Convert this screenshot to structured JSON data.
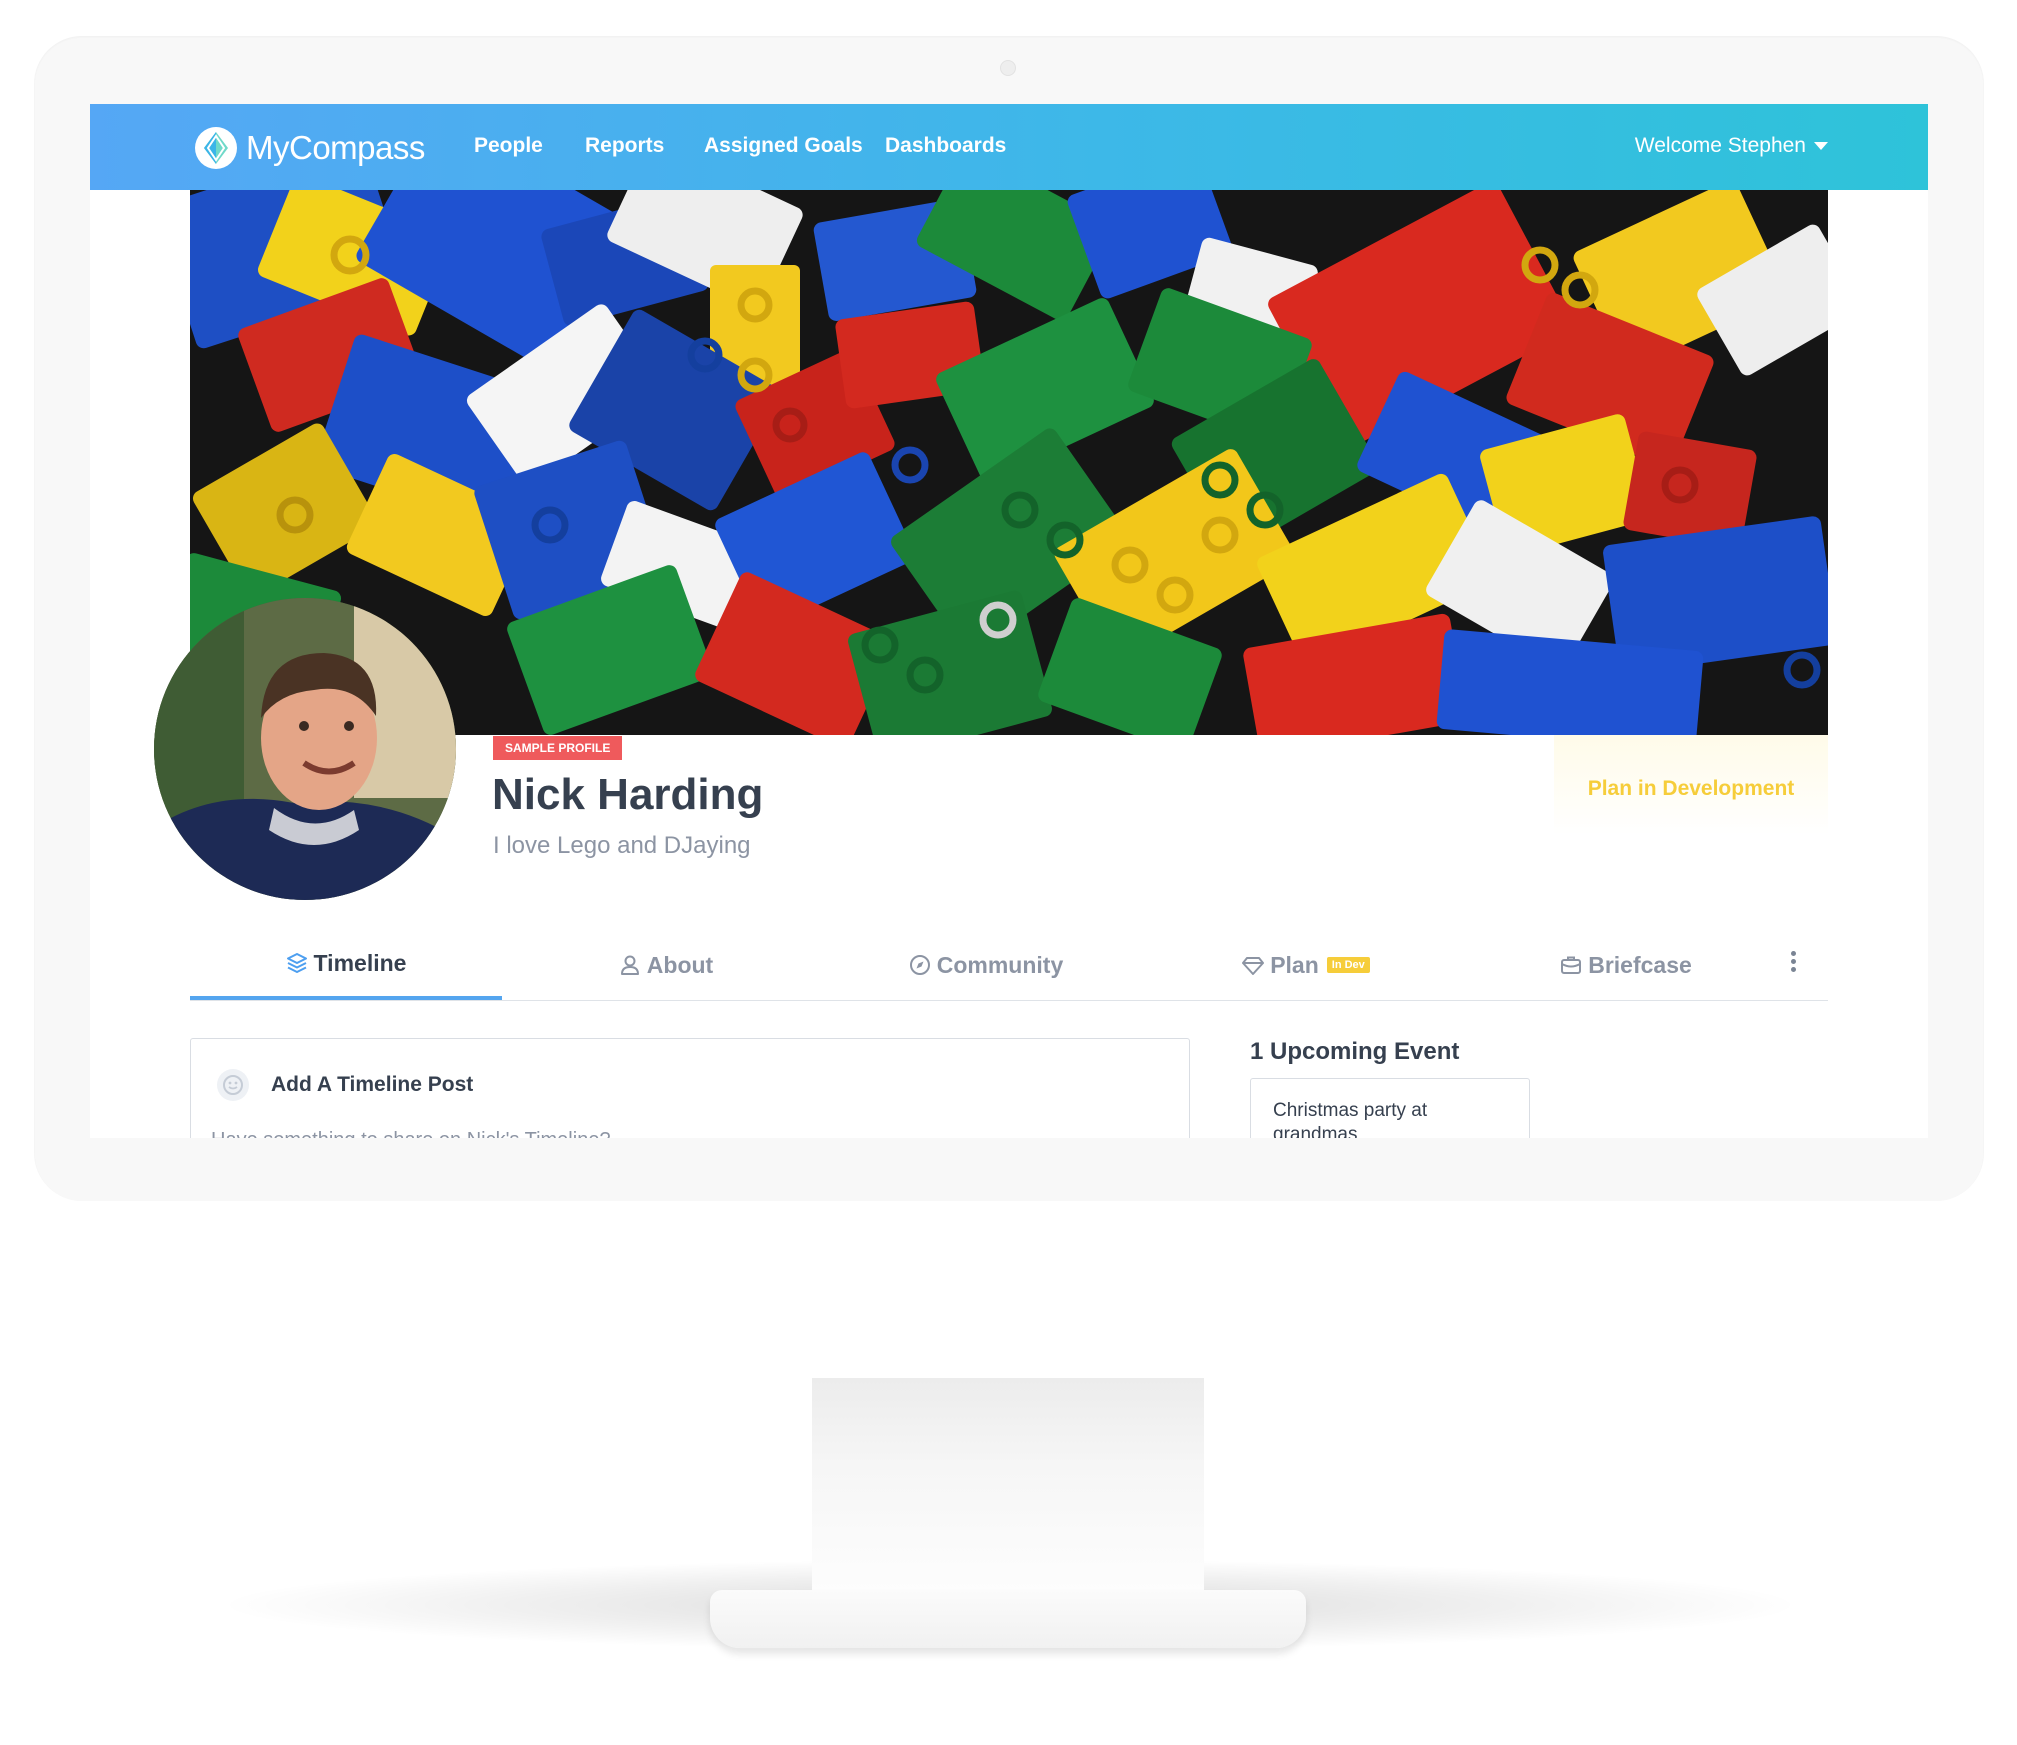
{
  "app": {
    "brand": "MyCompass",
    "nav": {
      "people": "People",
      "reports": "Reports",
      "assigned_goals": "Assigned Goals",
      "dashboards": "Dashboards"
    },
    "welcome": "Welcome Stephen"
  },
  "profile": {
    "badge": "SAMPLE PROFILE",
    "name": "Nick Harding",
    "bio": "I love Lego and DJaying",
    "plan_status": "Plan in Development"
  },
  "tabs": {
    "timeline": "Timeline",
    "about": "About",
    "community": "Community",
    "plan": "Plan",
    "plan_badge": "In Dev",
    "briefcase": "Briefcase",
    "active": "Timeline"
  },
  "timeline_post": {
    "title": "Add A Timeline Post",
    "placeholder": "Have something to share on Nick's Timeline?"
  },
  "events": {
    "title": "1 Upcoming Event",
    "items": [
      {
        "title": "Christmas party at grandmas"
      }
    ]
  },
  "colors": {
    "nav_gradient_start": "#55a7f5",
    "nav_gradient_end": "#2ec3d9",
    "sample_badge": "#ef5a5c",
    "plan_yellow": "#f6cd3a",
    "active_tab_underline": "#54a5ef",
    "heading_text": "#36404f",
    "muted_text": "#8c94a3"
  },
  "icons": {
    "brand": "compass-logo-icon",
    "welcome_caret": "caret-down-icon",
    "timeline": "layers-icon",
    "about": "user-icon",
    "community": "compass-icon",
    "plan": "diamond-icon",
    "briefcase": "briefcase-icon",
    "more": "more-vertical-icon",
    "post": "smiley-icon"
  }
}
